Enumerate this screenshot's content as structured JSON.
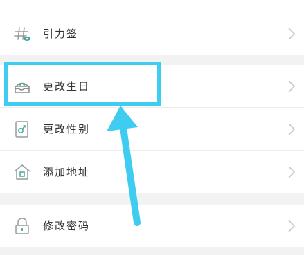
{
  "settings_list": {
    "items": [
      {
        "label": "引力签",
        "icon": "hashtag-icon"
      },
      {
        "label": "更改生日",
        "icon": "birthday-cake-icon"
      },
      {
        "label": "更改性别",
        "icon": "gender-icon"
      },
      {
        "label": "添加地址",
        "icon": "house-icon"
      },
      {
        "label": "修改密码",
        "icon": "lock-icon"
      }
    ]
  },
  "annotation": {
    "highlight_color": "#3ecdf0",
    "target": "更改生日"
  }
}
